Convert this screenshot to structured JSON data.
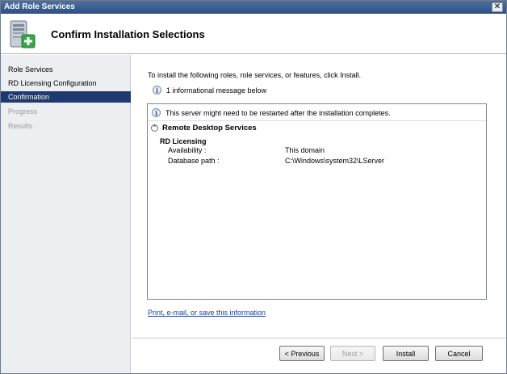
{
  "window": {
    "title": "Add Role Services",
    "close_glyph": "✕"
  },
  "header": {
    "title": "Confirm Installation Selections",
    "icon": "server-add-icon"
  },
  "nav": {
    "items": [
      {
        "label": "Role Services",
        "state": "normal"
      },
      {
        "label": "RD Licensing Configuration",
        "state": "normal"
      },
      {
        "label": "Confirmation",
        "state": "active"
      },
      {
        "label": "Progress",
        "state": "disabled"
      },
      {
        "label": "Results",
        "state": "disabled"
      }
    ]
  },
  "content": {
    "intro": "To install the following roles, role services, or features, click Install.",
    "info_message": "1 informational message below",
    "details": {
      "warning": "This server might need to be restarted after the installation completes.",
      "section_title": "Remote Desktop Services",
      "role_title": "RD Licensing",
      "rows": [
        {
          "label": "Availability :",
          "value": "This domain"
        },
        {
          "label": "Database path :",
          "value": "C:\\Windows\\system32\\LServer"
        }
      ]
    },
    "link": "Print, e-mail, or save this information"
  },
  "buttons": {
    "previous": "< Previous",
    "next": "Next >",
    "install": "Install",
    "cancel": "Cancel"
  },
  "colors": {
    "title_bar": "#2c4f86",
    "nav_active": "#1f3a70",
    "link": "#1a3fa0"
  }
}
